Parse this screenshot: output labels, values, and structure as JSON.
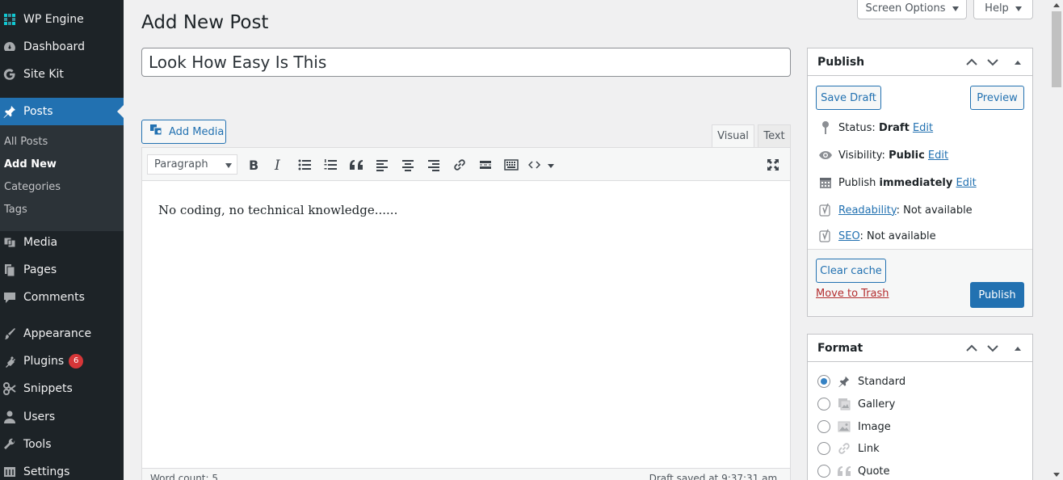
{
  "sidebar": {
    "items": [
      {
        "label": "WP Engine",
        "icon": "wp-engine-icon"
      },
      {
        "label": "Dashboard",
        "icon": "dashboard-icon"
      },
      {
        "label": "Site Kit",
        "icon": "google-g-icon"
      },
      {
        "label": "Posts",
        "icon": "pushpin-icon"
      },
      {
        "label": "Media",
        "icon": "media-icon"
      },
      {
        "label": "Pages",
        "icon": "pages-icon"
      },
      {
        "label": "Comments",
        "icon": "comment-icon"
      },
      {
        "label": "Appearance",
        "icon": "paintbrush-icon"
      },
      {
        "label": "Plugins",
        "icon": "plugin-icon",
        "badge": "6"
      },
      {
        "label": "Snippets",
        "icon": "scissors-icon"
      },
      {
        "label": "Users",
        "icon": "user-icon"
      },
      {
        "label": "Tools",
        "icon": "wrench-icon"
      },
      {
        "label": "Settings",
        "icon": "settings-icon"
      }
    ],
    "submenu": [
      "All Posts",
      "Add New",
      "Categories",
      "Tags"
    ]
  },
  "header": {
    "screen_options": "Screen Options",
    "help": "Help",
    "page_title": "Add New Post"
  },
  "post": {
    "title": "Look How Easy Is This",
    "content": "No coding, no technical knowledge......"
  },
  "editor": {
    "add_media": "Add Media",
    "tab_visual": "Visual",
    "tab_text": "Text",
    "format_select": "Paragraph",
    "word_count": "Word count: 5",
    "draft_saved": "Draft saved at 9:37:31 am."
  },
  "publish_box": {
    "title": "Publish",
    "save_draft": "Save Draft",
    "preview": "Preview",
    "status_label": "Status:",
    "status_value": "Draft",
    "visibility_label": "Visibility:",
    "visibility_value": "Public",
    "publish_label": "Publish",
    "publish_value": "immediately",
    "edit": "Edit",
    "readability_link": "Readability",
    "readability_value": ": Not available",
    "seo_link": "SEO",
    "seo_value": ": Not available",
    "clear_cache": "Clear cache",
    "move_to_trash": "Move to Trash",
    "publish_button": "Publish"
  },
  "format_box": {
    "title": "Format",
    "options": [
      {
        "label": "Standard",
        "icon": "pushpin-icon",
        "checked": true
      },
      {
        "label": "Gallery",
        "icon": "gallery-icon",
        "checked": false
      },
      {
        "label": "Image",
        "icon": "image-icon",
        "checked": false
      },
      {
        "label": "Link",
        "icon": "link-icon",
        "checked": false
      },
      {
        "label": "Quote",
        "icon": "quote-icon",
        "checked": false
      }
    ]
  },
  "colors": {
    "sidebar_bg": "#1d2327",
    "accent": "#2271b1",
    "badge": "#d63638",
    "trash": "#b32d2e"
  }
}
